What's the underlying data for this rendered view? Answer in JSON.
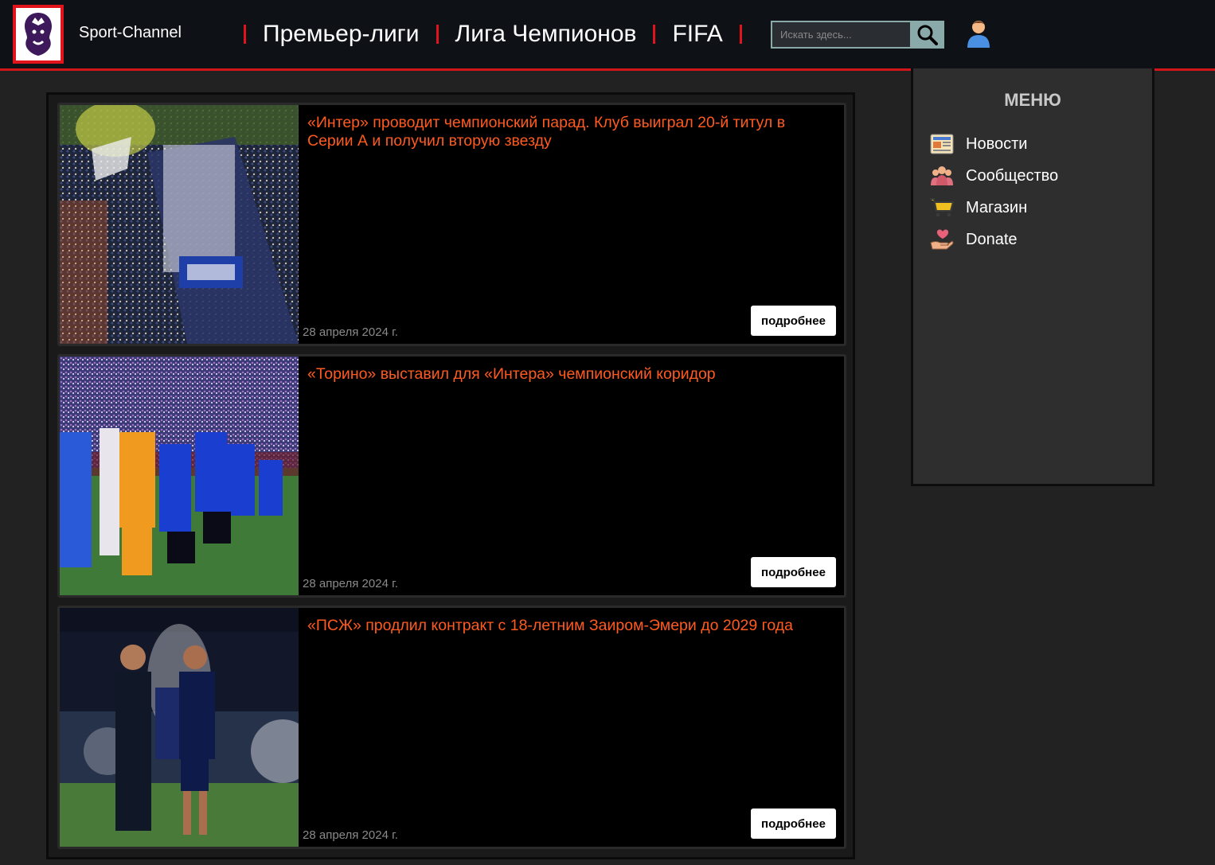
{
  "header": {
    "brand": "Sport-Channel",
    "nav": [
      "Премьер-лиги",
      "Лига Чемпионов",
      "FIFA"
    ],
    "search_placeholder": "Искать здесь...",
    "colors": {
      "accent": "#e0141a",
      "header_bg": "#0e1217",
      "search_btn": "#8aa9a9"
    }
  },
  "feed": {
    "items": [
      {
        "title": "«Интер» проводит чемпионский парад. Клуб выиграл 20-й титул в Серии А и получил вторую звезду",
        "date": "28 апреля 2024 г.",
        "button": "подробнее"
      },
      {
        "title": "«Торино» выставил для «Интера» чемпионский коридор",
        "date": "28 апреля 2024 г.",
        "button": "подробнее"
      },
      {
        "title": "«ПСЖ» продлил контракт с 18-летним Заиром-Эмери до 2029 года",
        "date": "28 апреля 2024 г.",
        "button": "подробнее"
      }
    ],
    "title_color": "#ff5a1f"
  },
  "sidebar": {
    "title": "МЕНЮ",
    "items": [
      {
        "label": "Новости",
        "icon": "newspaper-icon"
      },
      {
        "label": "Сообщество",
        "icon": "community-icon"
      },
      {
        "label": "Магазин",
        "icon": "cart-icon"
      },
      {
        "label": "Donate",
        "icon": "donate-heart-icon"
      }
    ]
  }
}
